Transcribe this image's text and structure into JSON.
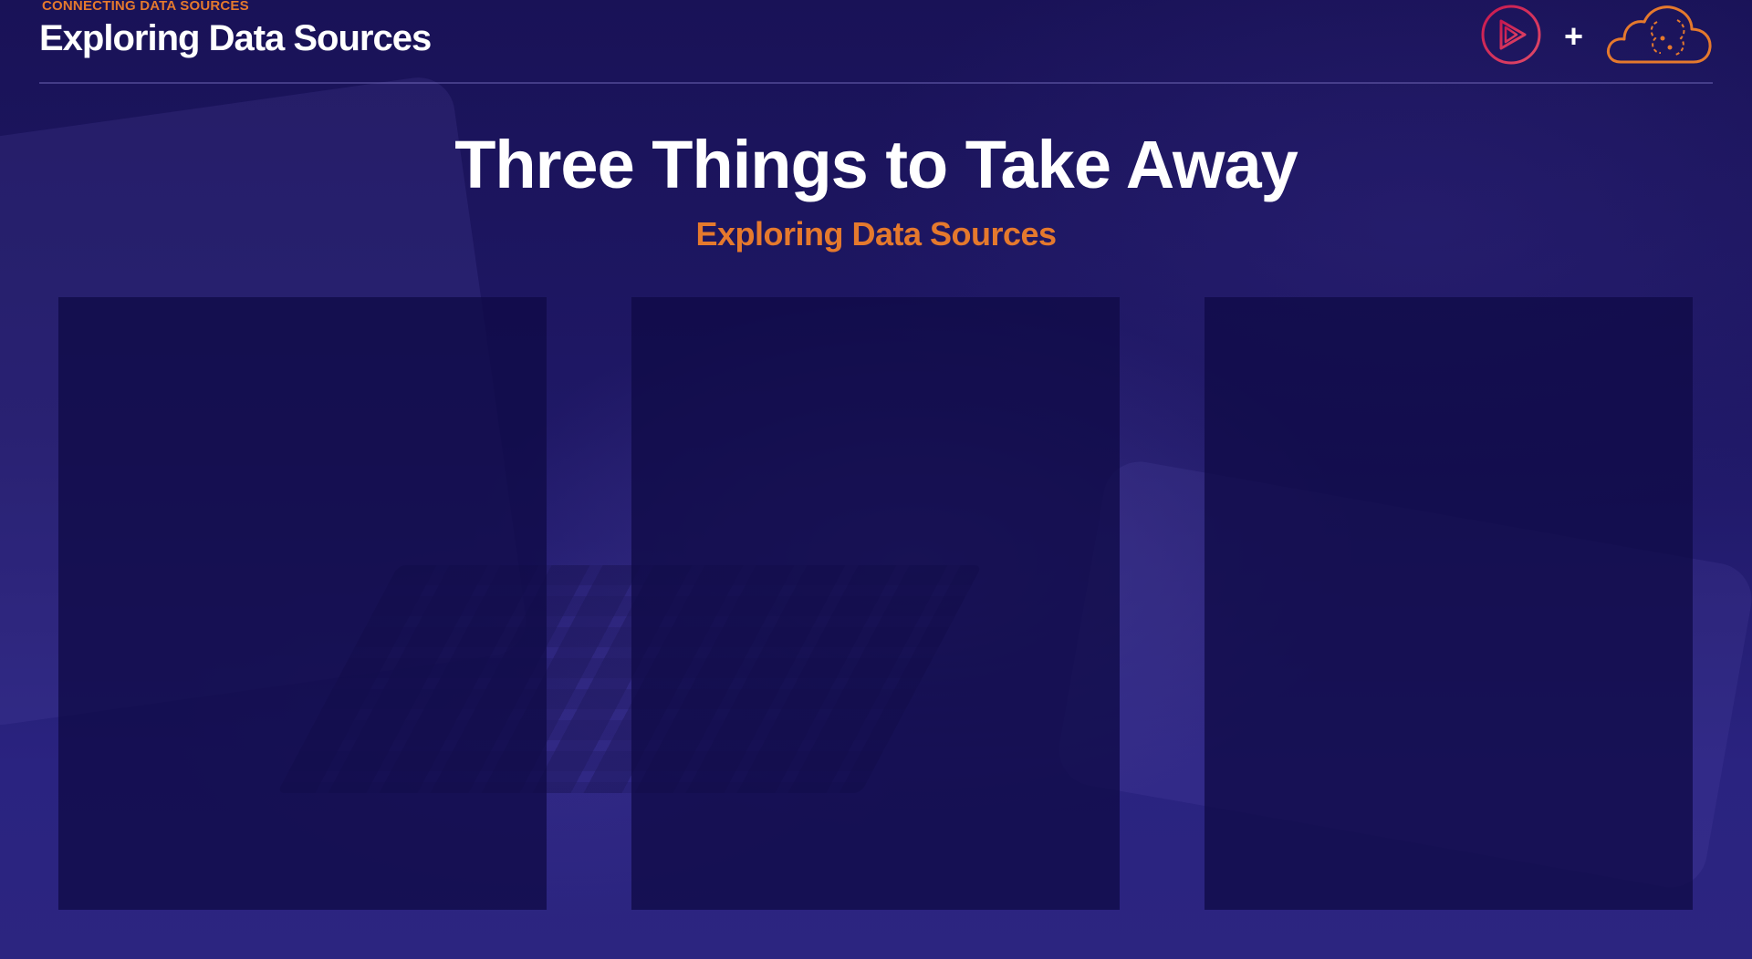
{
  "header": {
    "kicker": "CONNECTING DATA SOURCES",
    "title": "Exploring Data Sources"
  },
  "logos": {
    "left_icon": "play-triangle-icon",
    "separator": "+",
    "right_icon": "cloud-brain-icon",
    "colors": {
      "play_start": "#c8184f",
      "play_end": "#e5792d",
      "cloud": "#e5792d",
      "plus": "#ffffff"
    }
  },
  "slide": {
    "title": "Three Things to Take Away",
    "subtitle": "Exploring Data Sources"
  },
  "panels": [
    {
      "id": "takeaway-1",
      "text": ""
    },
    {
      "id": "takeaway-2",
      "text": ""
    },
    {
      "id": "takeaway-3",
      "text": ""
    }
  ],
  "colors": {
    "background": "#1b1460",
    "accent": "#e5792d",
    "panel": "#100a46",
    "text": "#ffffff"
  }
}
